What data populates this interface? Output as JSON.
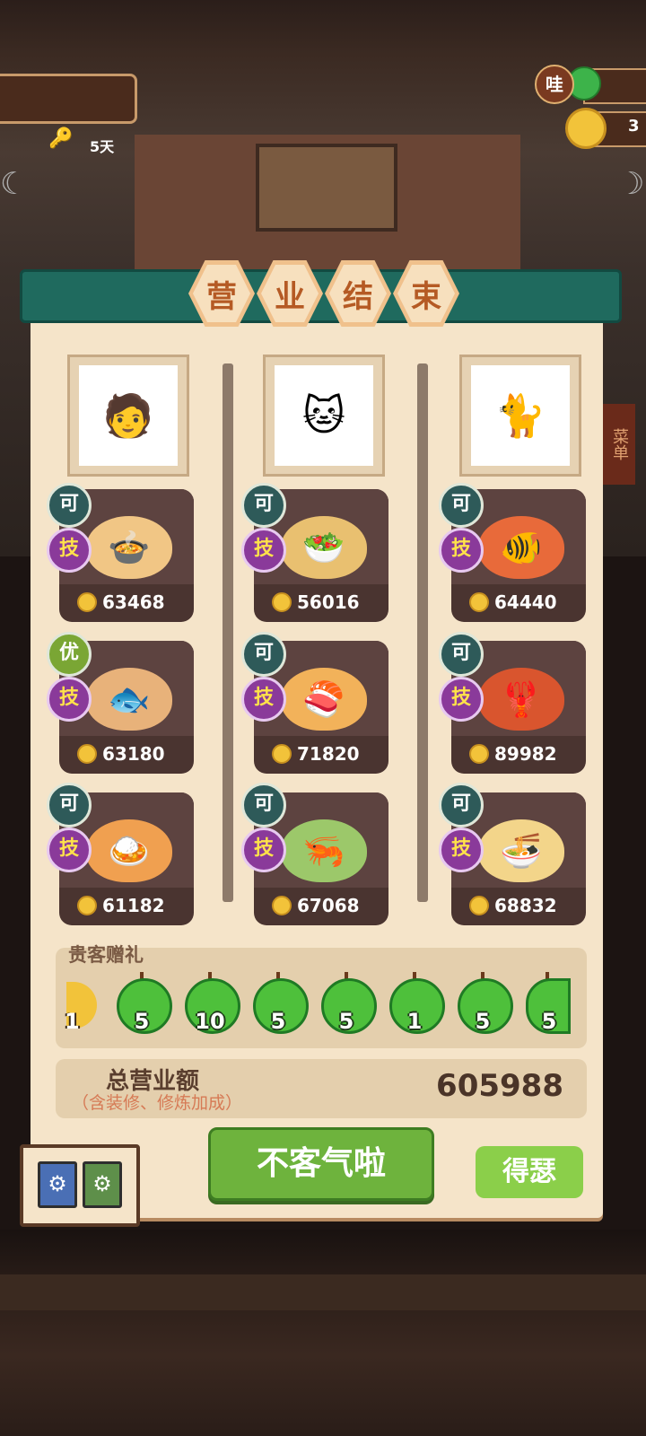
{
  "hud": {
    "days": "5天",
    "wa": "哇",
    "coin_partial": "3"
  },
  "title_chars": [
    "营",
    "业",
    "结",
    "束"
  ],
  "side_menu": "菜单",
  "columns": [
    {
      "dishes": [
        {
          "badge": "可",
          "skill": "技",
          "price": "63468"
        },
        {
          "badge": "优",
          "skill": "技",
          "price": "63180"
        },
        {
          "badge": "可",
          "skill": "技",
          "price": "61182"
        }
      ]
    },
    {
      "dishes": [
        {
          "badge": "可",
          "skill": "技",
          "price": "56016"
        },
        {
          "badge": "可",
          "skill": "技",
          "price": "71820"
        },
        {
          "badge": "可",
          "skill": "技",
          "price": "67068"
        }
      ]
    },
    {
      "dishes": [
        {
          "badge": "可",
          "skill": "技",
          "price": "64440"
        },
        {
          "badge": "可",
          "skill": "技",
          "price": "89982"
        },
        {
          "badge": "可",
          "skill": "技",
          "price": "68832"
        }
      ]
    }
  ],
  "gifts": {
    "title": "贵客赠礼",
    "first_count": "1",
    "counts": [
      "5",
      "10",
      "5",
      "5",
      "1",
      "5",
      "5"
    ]
  },
  "total": {
    "label": "总营业额",
    "note": "（含装修、修炼加成）",
    "value": "605988"
  },
  "buttons": {
    "main": "不客气啦",
    "side": "得瑟"
  },
  "colors": {
    "panel": "#f5e4c9",
    "banner": "#1f6a5e",
    "main_button": "#6eb33d",
    "skill_badge": "#8a3a9a",
    "ke_badge": "#2e5a59",
    "you_badge": "#7aa634"
  }
}
